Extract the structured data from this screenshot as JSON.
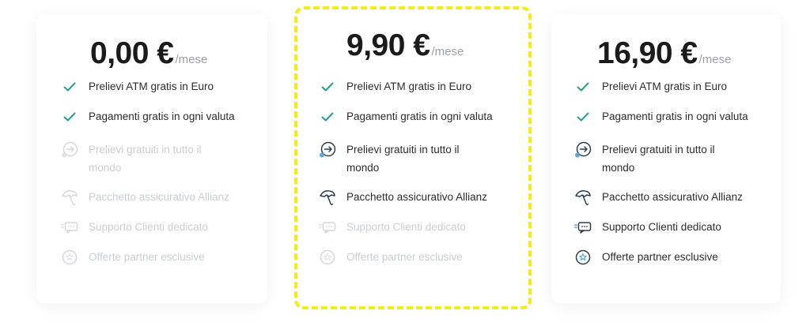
{
  "plans": [
    {
      "price": "0,00 €",
      "per": "/mese",
      "features": [
        {
          "label": "Prelievi ATM gratis in Euro",
          "icon": "check-icon",
          "enabled": true
        },
        {
          "label": "Pagamenti gratis in ogni valuta",
          "icon": "check-icon",
          "enabled": true
        },
        {
          "label": "Prelievi gratuiti in tutto il",
          "label2": "mondo",
          "icon": "arrow-circle-icon",
          "enabled": false
        },
        {
          "label": "Pacchetto assicurativo Allianz",
          "icon": "umbrella-icon",
          "enabled": false
        },
        {
          "label": "Supporto Clienti dedicato",
          "icon": "chat-icon",
          "enabled": false
        },
        {
          "label": "Offerte partner esclusive",
          "icon": "star-badge-icon",
          "enabled": false
        }
      ]
    },
    {
      "price": "9,90 €",
      "per": "/mese",
      "features": [
        {
          "label": "Prelievi ATM gratis in Euro",
          "icon": "check-icon",
          "enabled": true
        },
        {
          "label": "Pagamenti gratis in ogni valuta",
          "icon": "check-icon",
          "enabled": true
        },
        {
          "label": "Prelievi gratuiti in tutto il",
          "label2": "mondo",
          "icon": "arrow-circle-icon",
          "enabled": true
        },
        {
          "label": "Pacchetto assicurativo Allianz",
          "icon": "umbrella-icon",
          "enabled": true
        },
        {
          "label": "Supporto Clienti dedicato",
          "icon": "chat-icon",
          "enabled": false
        },
        {
          "label": "Offerte partner esclusive",
          "icon": "star-badge-icon",
          "enabled": false
        }
      ]
    },
    {
      "price": "16,90 €",
      "per": "/mese",
      "features": [
        {
          "label": "Prelievi ATM gratis in Euro",
          "icon": "check-icon",
          "enabled": true
        },
        {
          "label": "Pagamenti gratis in ogni valuta",
          "icon": "check-icon",
          "enabled": true
        },
        {
          "label": "Prelievi gratuiti in tutto il",
          "label2": "mondo",
          "icon": "arrow-circle-icon",
          "enabled": true
        },
        {
          "label": "Pacchetto assicurativo Allianz",
          "icon": "umbrella-icon",
          "enabled": true
        },
        {
          "label": "Supporto Clienti dedicato",
          "icon": "chat-icon",
          "enabled": true
        },
        {
          "label": "Offerte partner esclusive",
          "icon": "star-badge-icon",
          "enabled": true
        }
      ]
    }
  ],
  "colors": {
    "check": "#2a9d8f",
    "highlight_border": "#f3ec19",
    "disabled": "#c8cdd2",
    "per_month": "#9aa0a6"
  }
}
